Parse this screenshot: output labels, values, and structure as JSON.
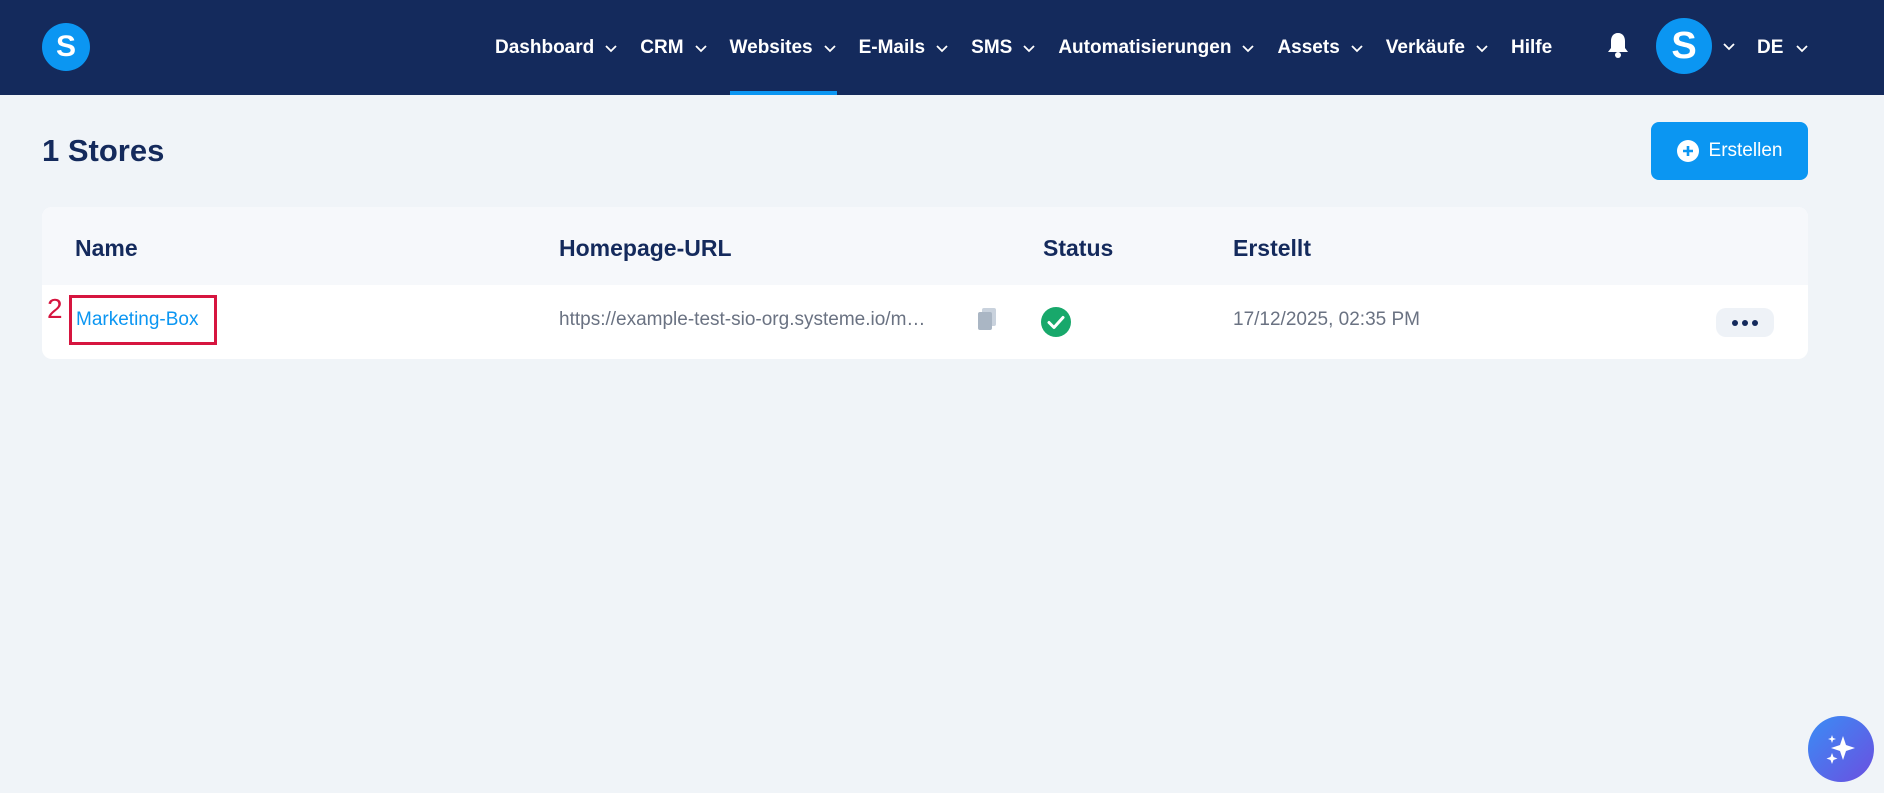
{
  "logo": {
    "letter": "S"
  },
  "nav": {
    "items": [
      {
        "label": "Dashboard",
        "active": false
      },
      {
        "label": "CRM",
        "active": false
      },
      {
        "label": "Websites",
        "active": true
      },
      {
        "label": "E-Mails",
        "active": false
      },
      {
        "label": "SMS",
        "active": false
      },
      {
        "label": "Automatisierungen",
        "active": false
      },
      {
        "label": "Assets",
        "active": false
      },
      {
        "label": "Verkäufe",
        "active": false
      }
    ],
    "help_label": "Hilfe",
    "bell_icon": "bell-icon",
    "avatar_letter": "S",
    "language": "DE"
  },
  "page": {
    "title": "1 Stores",
    "create_label": "Erstellen"
  },
  "table": {
    "columns": [
      "Name",
      "Homepage-URL",
      "Status",
      "Erstellt"
    ],
    "rows": [
      {
        "marker": "2",
        "name": "Marketing-Box",
        "url": "https://example-test-sio-org.systeme.io/m…",
        "status_icon": "check-circle-icon",
        "created": "17/12/2025, 02:35 PM"
      }
    ]
  },
  "colors": {
    "topbar": "#142a5c",
    "accent": "#0b96f2",
    "status_ok": "#18a86b",
    "marker": "#d6153f"
  },
  "ai_button": {
    "icon": "sparkle-icon"
  }
}
